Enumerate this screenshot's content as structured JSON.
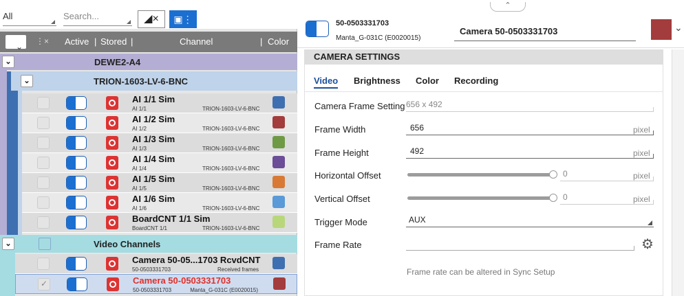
{
  "filter": {
    "channel_type": "All",
    "search_placeholder": "Search..."
  },
  "header": {
    "active": "Active",
    "stored": "Stored",
    "channel": "Channel",
    "color": "Color"
  },
  "groups": {
    "dewe": "DEWE2-A4",
    "trion": "TRION-1603-LV-6-BNC",
    "video": "Video Channels"
  },
  "channels": [
    {
      "name": "AI 1/1 Sim",
      "sub": "AI 1/1",
      "device": "TRION-1603-LV-6-BNC",
      "color": "#3e6fb0"
    },
    {
      "name": "AI 1/2 Sim",
      "sub": "AI 1/2",
      "device": "TRION-1603-LV-6-BNC",
      "color": "#a33c3c"
    },
    {
      "name": "AI 1/3 Sim",
      "sub": "AI 1/3",
      "device": "TRION-1603-LV-6-BNC",
      "color": "#6f9a45"
    },
    {
      "name": "AI 1/4 Sim",
      "sub": "AI 1/4",
      "device": "TRION-1603-LV-6-BNC",
      "color": "#6c4d97"
    },
    {
      "name": "AI 1/5 Sim",
      "sub": "AI 1/5",
      "device": "TRION-1603-LV-6-BNC",
      "color": "#d87a35"
    },
    {
      "name": "AI 1/6 Sim",
      "sub": "AI 1/6",
      "device": "TRION-1603-LV-6-BNC",
      "color": "#5a9ad8"
    },
    {
      "name": "BoardCNT 1/1 Sim",
      "sub": "BoardCNT 1/1",
      "device": "TRION-1603-LV-6-BNC",
      "color": "#b8d77a"
    }
  ],
  "video_channels": [
    {
      "name": "Camera 50-05...1703 RcvdCNT",
      "sub": "50-0503331703",
      "device": "Received frames",
      "color": "#3e6fb0"
    },
    {
      "name": "Camera 50-0503331703",
      "sub": "50-0503331703",
      "device": "Manta_G-031C (E0020015)",
      "color": "#a33c3c"
    }
  ],
  "camera": {
    "id": "50-0503331703",
    "model": "Manta_G-031C (E0020015)",
    "title": "Camera 50-0503331703",
    "color": "#a33c3c"
  },
  "settings": {
    "section": "CAMERA SETTINGS",
    "tabs": [
      "Video",
      "Brightness",
      "Color",
      "Recording"
    ],
    "frame_setting_label": "Camera Frame Setting",
    "frame_setting_value": "656 x 492",
    "width_label": "Frame Width",
    "width_value": "656",
    "height_label": "Frame Height",
    "height_value": "492",
    "hoffset_label": "Horizontal Offset",
    "hoffset_value": "0",
    "voffset_label": "Vertical Offset",
    "voffset_value": "0",
    "unit": "pixel",
    "trigger_label": "Trigger Mode",
    "trigger_value": "AUX",
    "framerate_label": "Frame Rate",
    "note": "Frame rate can be altered in Sync Setup"
  }
}
